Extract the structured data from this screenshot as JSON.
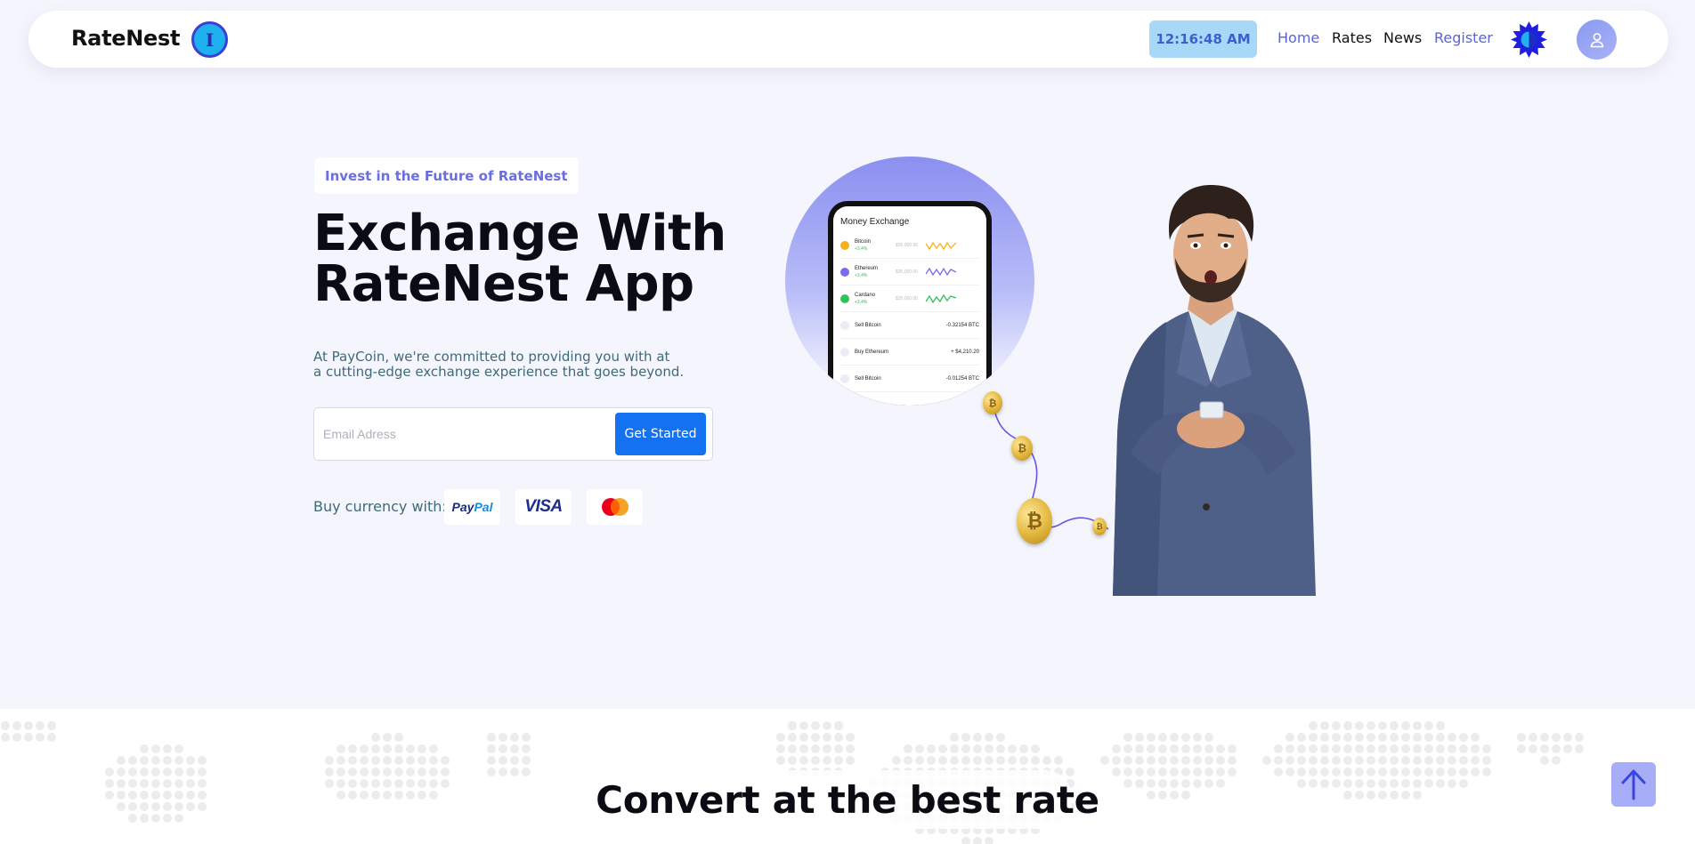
{
  "header": {
    "brand": "RateNest",
    "brand_badge_glyph": "I",
    "clock": "12:16:48 AM",
    "nav": [
      {
        "label": "Home",
        "active": true
      },
      {
        "label": "Rates",
        "active": false
      },
      {
        "label": "News",
        "active": false
      },
      {
        "label": "Register",
        "active": true
      }
    ],
    "theme_icon": "sun-icon",
    "user_icon": "user-icon",
    "accent_color": "#5a64d8"
  },
  "hero": {
    "badge": "Invest in the Future of RateNest",
    "title_line1": "Exchange With",
    "title_line2": "RateNest App",
    "description_line1": "At PayCoin, we're committed to providing you with at",
    "description_line2": "a cutting-edge exchange experience that goes beyond.",
    "email_placeholder": "Email Adress",
    "cta_label": "Get Started",
    "buy_with_label": "Buy currency with:",
    "payment_methods": [
      {
        "name": "PayPal",
        "icon": "paypal-logo"
      },
      {
        "name": "VISA",
        "icon": "visa-logo"
      },
      {
        "name": "Mastercard",
        "icon": "mastercard-logo"
      }
    ],
    "cta_color": "#1471f0"
  },
  "phone": {
    "title": "Money Exchange",
    "coins": [
      {
        "name": "Bitcoin",
        "change": "+3.4%",
        "price": "$35,000.00",
        "color": "#f6b21a"
      },
      {
        "name": "Ethereum",
        "change": "+3.4%",
        "price": "$35,000.00",
        "color": "#7a6af0"
      },
      {
        "name": "Cardano",
        "change": "+3.4%",
        "price": "$35,000.00",
        "color": "#2fc25b"
      }
    ],
    "transactions": [
      {
        "name": "Sell Bitcoin",
        "value": "-0.32154 BTC"
      },
      {
        "name": "Buy Ethereum",
        "value": "+ $4,210.20"
      },
      {
        "name": "Sell Bitcoin",
        "value": "-0.01254 BTC"
      }
    ]
  },
  "section": {
    "title": "Convert at the best rate"
  },
  "scroll_top_icon": "arrow-up-icon"
}
